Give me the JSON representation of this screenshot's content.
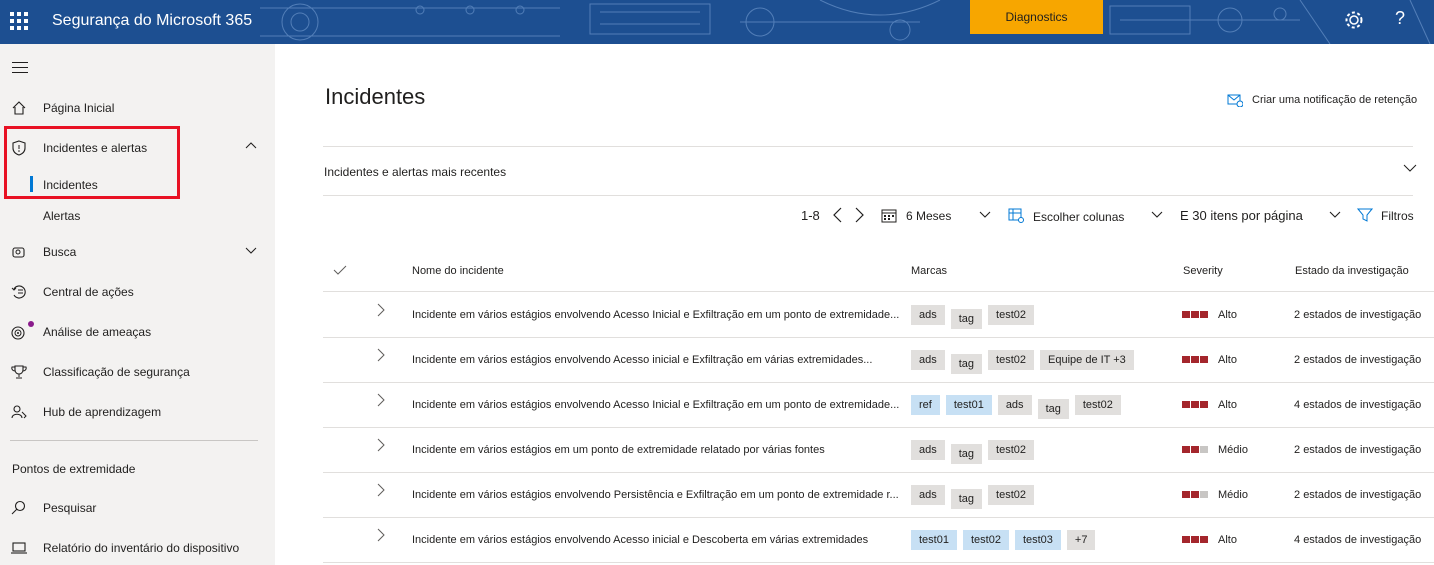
{
  "header": {
    "app_title": "Segurança do Microsoft 365",
    "diagnostics_label": "Diagnostics",
    "help_label": "?",
    "brand_color": "#1d4f91",
    "diagnostics_color": "#f7a600"
  },
  "sidebar": {
    "items": [
      {
        "label": "Página Inicial",
        "icon": "home-icon"
      },
      {
        "label": "Incidentes e alertas",
        "icon": "shield-icon"
      },
      {
        "label": "Incidentes"
      },
      {
        "label": "Alertas"
      },
      {
        "label": "Busca",
        "icon": "hunting-icon"
      },
      {
        "label": "Central de ações",
        "icon": "action-center-icon"
      },
      {
        "label": "Análise de ameaças",
        "icon": "threat-analytics-icon"
      },
      {
        "label": "Classificação de segurança",
        "icon": "trophy-icon"
      },
      {
        "label": "Hub de aprendizagem",
        "icon": "learning-hub-icon"
      }
    ],
    "section_title": "Pontos de extremidade",
    "section_items": [
      {
        "label": "Pesquisar",
        "icon": "search-icon"
      },
      {
        "label": "Relatório do inventário do dispositivo",
        "icon": "device-inventory-icon"
      }
    ]
  },
  "main": {
    "title": "Incidentes",
    "retention_label": "Criar uma notificação de retenção",
    "recent_label": "Incidentes e alertas mais recentes",
    "toolbar": {
      "range": "1-8",
      "period": "6 Meses",
      "columns": "Escolher colunas",
      "per_page": "E 30 itens por página",
      "filters": "Filtros"
    },
    "columns": {
      "name": "Nome do incidente",
      "tags": "Marcas",
      "severity": "Severity",
      "investigation": "Estado da investigação"
    },
    "rows": [
      {
        "name": "Incidente em vários estágios envolvendo Acesso Inicial e Exfiltração em um ponto de extremidade...",
        "tags": [
          "ads",
          "tag",
          "test02"
        ],
        "severity": "Alto",
        "sev_level": 3,
        "inv_count": "2",
        "inv_label": "estados de investigação"
      },
      {
        "name": "Incidente em vários estágios envolvendo Acesso inicial e Exfiltração em várias extremidades...",
        "tags": [
          "ads",
          "tag",
          "test02",
          "Equipe de IT +3"
        ],
        "severity": "Alto",
        "sev_level": 3,
        "inv_count": "2",
        "inv_label": "estados de investigação"
      },
      {
        "name": "Incidente em vários estágios envolvendo Acesso Inicial e Exfiltração em um ponto de extremidade...",
        "tags_blue": [
          "ref",
          "test01"
        ],
        "tags": [
          "ads",
          "tag",
          "test02"
        ],
        "severity": "Alto",
        "sev_level": 3,
        "inv_count": "4",
        "inv_label": "estados de investigação"
      },
      {
        "name": "Incidente em vários estágios em um ponto de extremidade relatado por várias fontes",
        "tags": [
          "ads",
          "tag",
          "test02"
        ],
        "severity": "Médio",
        "sev_level": 2,
        "inv_count": "2",
        "inv_label": "estados de investigação"
      },
      {
        "name": "Incidente em vários estágios envolvendo Persistência e Exfiltração em um ponto de extremidade r...",
        "tags": [
          "ads",
          "tag",
          "test02"
        ],
        "severity": "Médio",
        "sev_level": 2,
        "inv_count": "2",
        "inv_label": "estados de investigação"
      },
      {
        "name": "Incidente em vários estágios envolvendo Acesso inicial e Descoberta em várias extremidades",
        "tags_blue": [
          "test01",
          "test02",
          "test03"
        ],
        "tags": [
          "+7"
        ],
        "severity": "Alto",
        "sev_level": 3,
        "inv_count": "4",
        "inv_label": "estados de investigação"
      }
    ],
    "severity_color": "#a4262c",
    "severity_empty_color": "#c8c6c4"
  }
}
